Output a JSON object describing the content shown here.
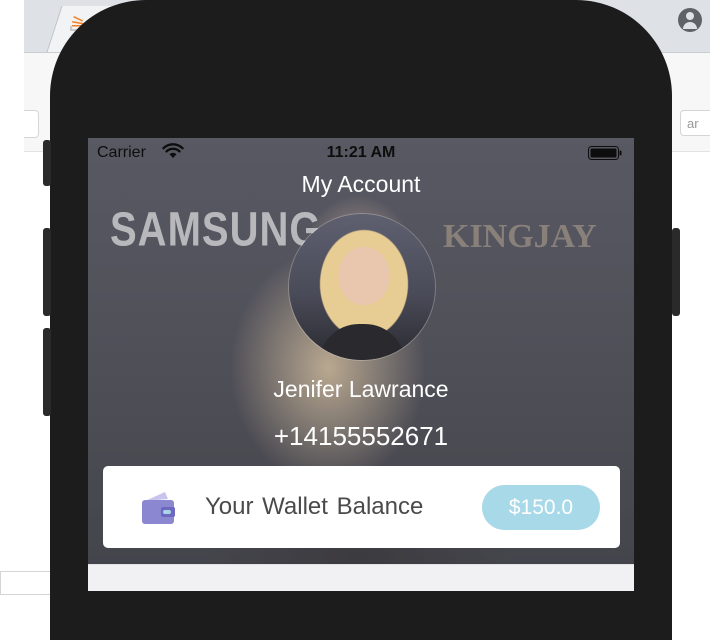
{
  "browser": {
    "toolbar_right_text": "ar"
  },
  "status_bar": {
    "carrier": "Carrier",
    "time": "11:21 AM"
  },
  "header": {
    "title": "My Account"
  },
  "profile": {
    "name": "Jenifer Lawrance",
    "phone": "+14155552671"
  },
  "wallet": {
    "label": "Your Wallet Balance",
    "balance": "$150.0"
  },
  "background_photo": {
    "brand_left": "SAMSUNG",
    "brand_right": "KINGJAY"
  },
  "colors": {
    "badge": "#a8d9e8",
    "wallet_icon": "#8b87d1",
    "phone_frame": "#1c1c1c"
  }
}
